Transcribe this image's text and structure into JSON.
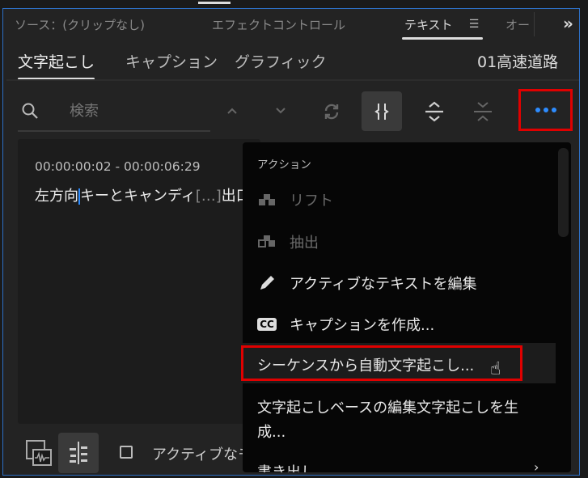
{
  "panel_tabs": [
    {
      "label": "ソース：(クリップなし)"
    },
    {
      "label": "エフェクトコントロール"
    },
    {
      "label": "テキスト",
      "active": true
    },
    {
      "label": "オー"
    }
  ],
  "overflow_label": "»",
  "sub_tabs": [
    {
      "label": "文字起こし",
      "active": true
    },
    {
      "label": "キャプション"
    },
    {
      "label": "グラフィック"
    }
  ],
  "sequence_name": "01高速道路",
  "search": {
    "placeholder": "検索",
    "value": ""
  },
  "transcript": {
    "timecode": "00:00:00:02 - 00:00:06:29",
    "text_before_cursor": "左方向",
    "text_after_cursor": "キーとキャンディ",
    "ellipsis": "[…]",
    "text_tail": "出口"
  },
  "menu": {
    "heading": "アクション",
    "items": [
      {
        "label": "リフト",
        "icon": "lift-icon",
        "disabled": true
      },
      {
        "label": "抽出",
        "icon": "extract-icon",
        "disabled": true
      },
      {
        "label": "アクティブなテキストを編集",
        "icon": "pencil-icon"
      },
      {
        "label": "キャプションを作成...",
        "icon": "cc-icon"
      },
      {
        "label": "シーケンスから自動文字起こし...",
        "highlighted": true
      },
      {
        "label": "文字起こしベースの編集文字起こしを生",
        "label2": "成..."
      },
      {
        "label": "書き出し",
        "submenu": true
      }
    ]
  },
  "bottom": {
    "checkbox_label": "アクティブなモ",
    "checked": false
  },
  "colors": {
    "accent": "#2d8cff",
    "highlight_box": "#e00000",
    "panel_border": "#2d6fc4"
  }
}
